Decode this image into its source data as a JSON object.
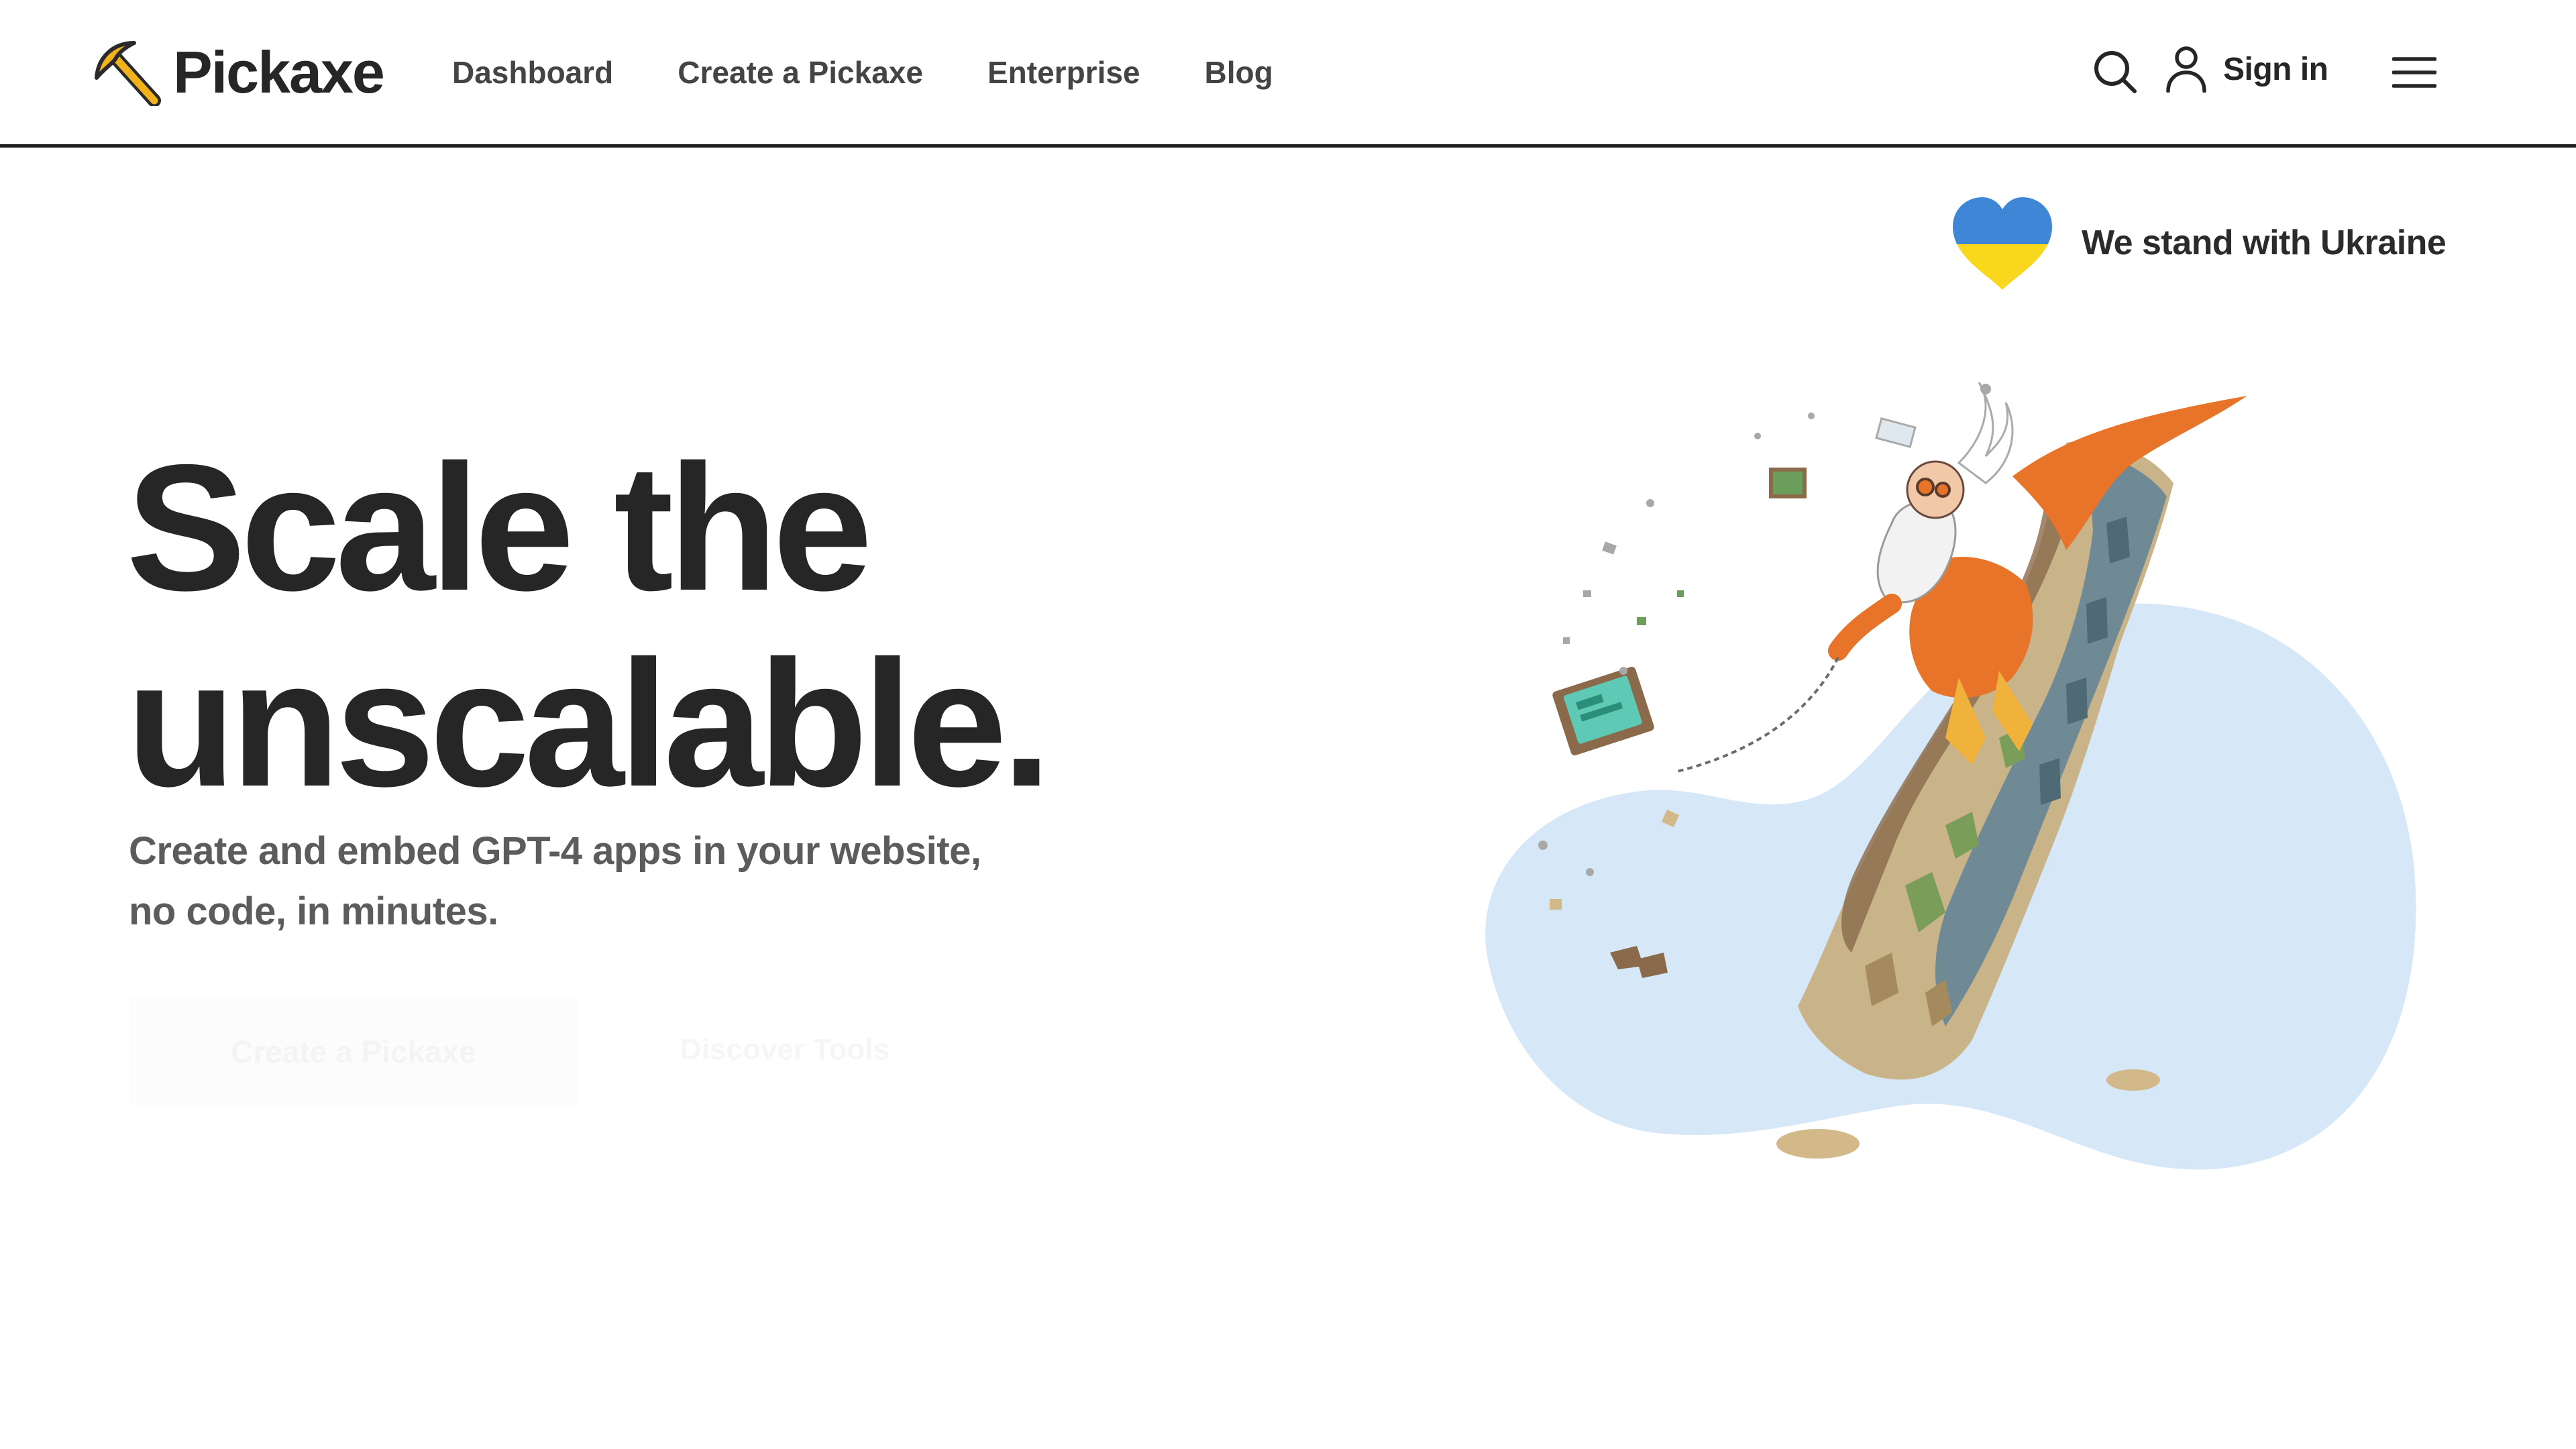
{
  "brand": {
    "name": "Pickaxe",
    "logo_icon": "pickaxe-icon"
  },
  "nav": {
    "items": [
      {
        "label": "Dashboard"
      },
      {
        "label": "Create a Pickaxe"
      },
      {
        "label": "Enterprise"
      },
      {
        "label": "Blog"
      }
    ]
  },
  "header_actions": {
    "search_icon": "search-icon",
    "signin_icon": "user-icon",
    "signin_label": "Sign in",
    "menu_icon": "hamburger-menu-icon"
  },
  "ukraine_badge": {
    "label": "We stand with Ukraine",
    "icon": "ukraine-heart-icon",
    "colors": {
      "top": "#3f86d6",
      "bottom": "#f9d71c"
    }
  },
  "hero": {
    "title_line1": "Scale the",
    "title_line2": "unscalable.",
    "subtitle_line1": "Create and embed GPT-4 apps in your website,",
    "subtitle_line2": "no code, in minutes.",
    "primary_cta": "Create a Pickaxe",
    "secondary_cta": "Discover Tools"
  },
  "illustration": {
    "subject": "wizard-climbing-cliff-illustration",
    "blob_color": "#d6e7f7",
    "cape_color": "#e8742a"
  },
  "colors": {
    "text_dark": "#262626",
    "text_muted": "#5c5c5c",
    "header_border": "#1e1e1e"
  }
}
